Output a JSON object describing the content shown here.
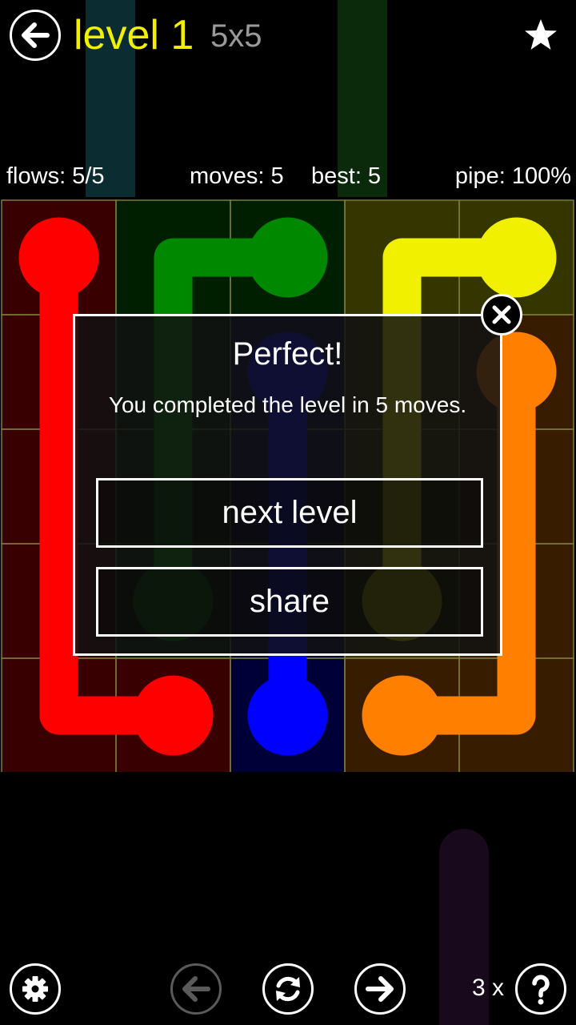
{
  "header": {
    "level": "level 1",
    "size": "5x5"
  },
  "stats": {
    "flows": "flows: 5/5",
    "moves": "moves: 5",
    "best": "best: 5",
    "pipe": "pipe: 100%"
  },
  "board": {
    "rows": 5,
    "cols": 5,
    "colors": {
      "red": "#ff0000",
      "green": "#008800",
      "blue": "#0000ff",
      "yellow": "#f0f000",
      "orange": "#ff8000"
    },
    "flows": [
      {
        "color": "red",
        "path": [
          [
            0,
            0
          ],
          [
            1,
            0
          ],
          [
            2,
            0
          ],
          [
            3,
            0
          ],
          [
            4,
            0
          ],
          [
            4,
            1
          ]
        ]
      },
      {
        "color": "green",
        "path": [
          [
            0,
            2
          ],
          [
            0,
            1
          ],
          [
            1,
            1
          ],
          [
            2,
            1
          ],
          [
            3,
            1
          ]
        ]
      },
      {
        "color": "blue",
        "path": [
          [
            1,
            2
          ],
          [
            2,
            2
          ],
          [
            3,
            2
          ],
          [
            4,
            2
          ]
        ]
      },
      {
        "color": "yellow",
        "path": [
          [
            0,
            4
          ],
          [
            0,
            3
          ],
          [
            1,
            3
          ],
          [
            2,
            3
          ],
          [
            3,
            3
          ]
        ]
      },
      {
        "color": "orange",
        "path": [
          [
            1,
            4
          ],
          [
            2,
            4
          ],
          [
            3,
            4
          ],
          [
            4,
            4
          ],
          [
            4,
            3
          ]
        ]
      }
    ]
  },
  "dialog": {
    "title": "Perfect!",
    "message": "You completed the level in 5 moves.",
    "next_label": "next level",
    "share_label": "share"
  },
  "footer": {
    "hints": "3 x"
  },
  "icons": {
    "back": "arrow-left-icon",
    "star": "star-icon",
    "close": "close-icon",
    "settings": "gear-icon",
    "prev": "arrow-left-icon",
    "reset": "refresh-icon",
    "next": "arrow-right-icon",
    "help": "question-icon"
  }
}
